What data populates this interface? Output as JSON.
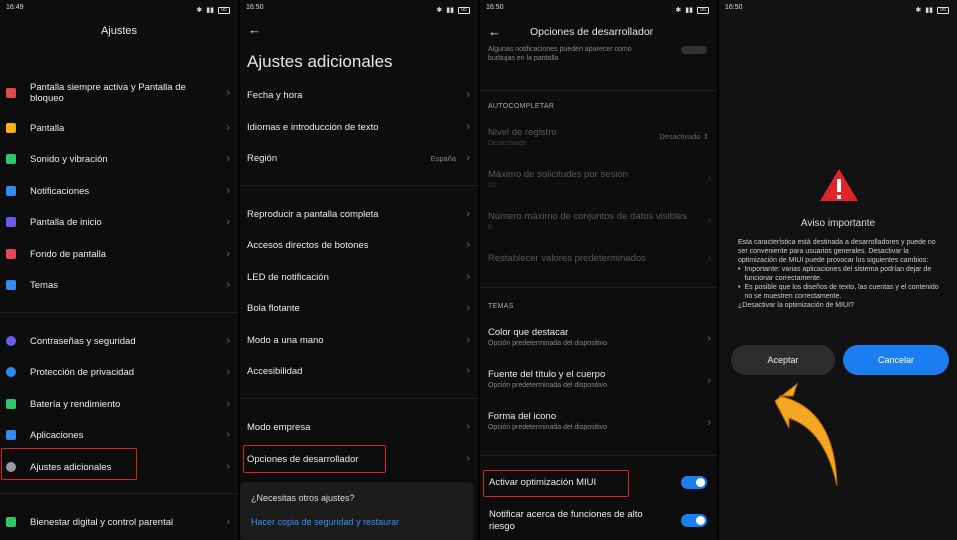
{
  "p1": {
    "time": "16:49",
    "battery": "95",
    "title": "Ajustes",
    "items": [
      {
        "label": "Pantalla siempre activa y Pantalla de bloqueo",
        "color": "#e24b4b"
      },
      {
        "label": "Pantalla",
        "color": "#f5b21b"
      },
      {
        "label": "Sonido y vibración",
        "color": "#2fc76b"
      },
      {
        "label": "Notificaciones",
        "color": "#2f8cf0"
      },
      {
        "label": "Pantalla de inicio",
        "color": "#6a5cf0"
      },
      {
        "label": "Fondo de pantalla",
        "color": "#e8455a"
      },
      {
        "label": "Temas",
        "color": "#2f8cf0"
      },
      {
        "label": "Contraseñas y seguridad",
        "color": "#6a5cf0"
      },
      {
        "label": "Protección de privacidad",
        "color": "#2f8cf0"
      },
      {
        "label": "Batería y rendimiento",
        "color": "#2fc76b"
      },
      {
        "label": "Aplicaciones",
        "color": "#2f8cf0"
      },
      {
        "label": "Ajustes adicionales",
        "color": "#9a9a9a"
      },
      {
        "label": "Bienestar digital y control parental",
        "color": "#2fc76b"
      }
    ]
  },
  "p2": {
    "time": "16:50",
    "battery": "95",
    "title": "Ajustes adicionales",
    "items": [
      {
        "label": "Fecha y hora",
        "value": ""
      },
      {
        "label": "Idiomas e introducción de texto",
        "value": ""
      },
      {
        "label": "Región",
        "value": "España"
      },
      {
        "label": "Reproducir a pantalla completa",
        "value": ""
      },
      {
        "label": "Accesos directos de botones",
        "value": ""
      },
      {
        "label": "LED de notificación",
        "value": ""
      },
      {
        "label": "Bola flotante",
        "value": ""
      },
      {
        "label": "Modo a una mano",
        "value": ""
      },
      {
        "label": "Accesibilidad",
        "value": ""
      },
      {
        "label": "Modo empresa",
        "value": ""
      },
      {
        "label": "Opciones de desarrollador",
        "value": ""
      }
    ],
    "card_title": "¿Necesitas otros ajustes?",
    "card_link": "Hacer copia de seguridad y restaurar"
  },
  "p3": {
    "time": "16:50",
    "battery": "95",
    "title": "Opciones de desarrollador",
    "top_note": "Algunas notificaciones pueden aparecer como burbujas en la pantalla",
    "section_autocomplete": "AUTOCOMPLETAR",
    "log_level": {
      "label": "Nivel de registro",
      "sub": "Desactivado",
      "value": "Desactivado"
    },
    "max_requests": {
      "label": "Máximo de solicitudes por sesión",
      "sub": "10"
    },
    "max_datasets": {
      "label": "Número máximo de conjuntos de datos visibles",
      "sub": "0"
    },
    "reset_defaults": "Restablecer valores predeterminados",
    "section_themes": "TEMAS",
    "theme_items": [
      {
        "label": "Color que destacar",
        "sub": "Opción predeterminada del dispositivo"
      },
      {
        "label": "Fuente del título y el cuerpo",
        "sub": "Opción predeterminada del dispositivo"
      },
      {
        "label": "Forma del icono",
        "sub": "Opción predeterminada del dispositivo"
      }
    ],
    "miui_opt": "Activar optimización MIUI",
    "notify_features": "Notificar acerca de funciones de alto riesgo"
  },
  "p4": {
    "time": "16:50",
    "battery": "95",
    "dialog_title": "Aviso importante",
    "body_intro": "Esta característica está destinada a desarrolladores y puede no ser conveniente para usuarios generales. Desactivar la optimización de MIUI puede provocar los siguientes cambios:",
    "bullet1": "Importante: varias aplicaciones del sistema podrían dejar de funcionar correctamente.",
    "bullet2": "Es posible que los diseños de texto, las cuentas y el contenido no se muestren correctamente.",
    "question": "¿Desactivar la optimización de MIUI?",
    "accept": "Aceptar",
    "cancel": "Cancelar",
    "warning_color": "#e0242c",
    "arrow_color": "#f5a623",
    "cancel_color": "#1a7ef0"
  }
}
